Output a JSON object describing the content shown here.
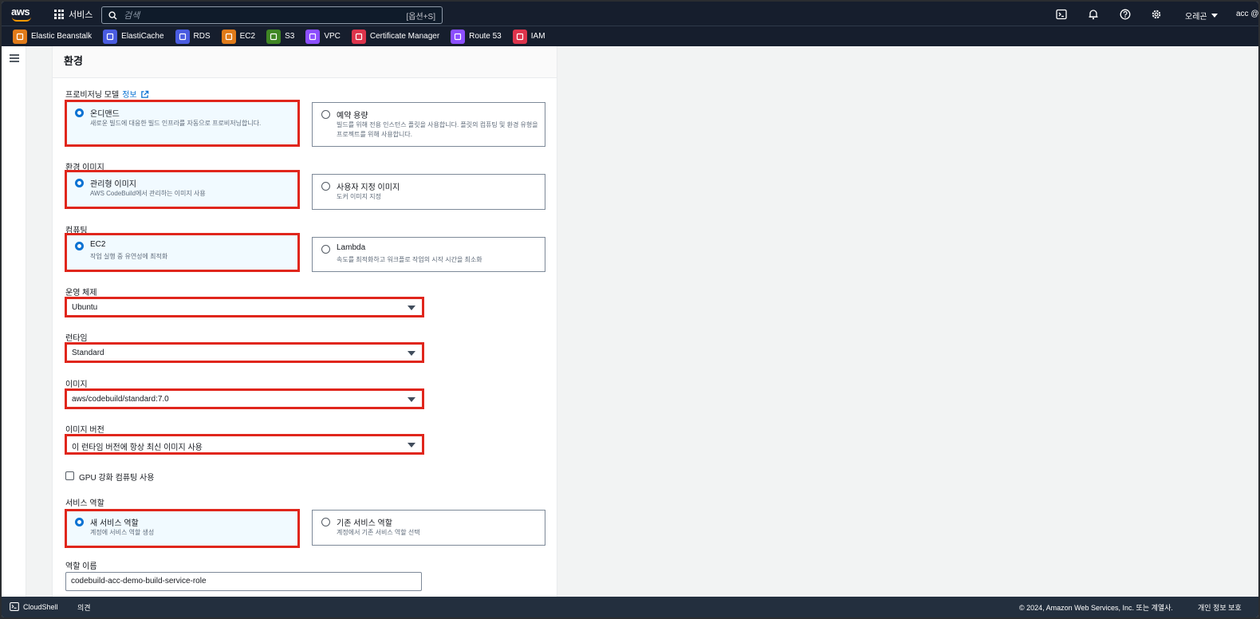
{
  "topnav": {
    "logo": "aws",
    "services_label": "서비스",
    "search_placeholder": "검색",
    "search_shortcut": "[옵션+S]",
    "region": "오레곤",
    "account": "acc @"
  },
  "favorites": [
    {
      "label": "Elastic Beanstalk",
      "color": "#e07b1a"
    },
    {
      "label": "ElastiCache",
      "color": "#4a5ce0"
    },
    {
      "label": "RDS",
      "color": "#4a5ce0"
    },
    {
      "label": "EC2",
      "color": "#e07b1a"
    },
    {
      "label": "S3",
      "color": "#3f8624"
    },
    {
      "label": "VPC",
      "color": "#8c4fff"
    },
    {
      "label": "Certificate Manager",
      "color": "#dd344c"
    },
    {
      "label": "Route 53",
      "color": "#8c4fff"
    },
    {
      "label": "IAM",
      "color": "#dd344c"
    }
  ],
  "panel": {
    "title": "환경",
    "provisioning": {
      "label": "프로비저닝 모델",
      "info": "정보",
      "options": [
        {
          "title": "온디맨드",
          "desc": "새로운 빌드에 대응한 빌드 인프라를 자동으로 프로비저닝합니다.",
          "selected": true
        },
        {
          "title": "예약 용량",
          "desc": "빌드를 위해 전용 인스턴스 플릿을 사용합니다. 플릿의 컴퓨팅 및 환경 유형을 프로젝트를 위해 사용합니다.",
          "selected": false
        }
      ]
    },
    "env_image": {
      "label": "환경 이미지",
      "options": [
        {
          "title": "관리형 이미지",
          "desc": "AWS CodeBuild에서 관리하는 이미지 사용",
          "selected": true
        },
        {
          "title": "사용자 지정 이미지",
          "desc": "도커 이미지 지정",
          "selected": false
        }
      ]
    },
    "compute": {
      "label": "컴퓨팅",
      "options": [
        {
          "title": "EC2",
          "desc": "작업 실행 중 유연성에 최적화",
          "selected": true
        },
        {
          "title": "Lambda",
          "desc": "속도를 최적화하고 워크플로 작업의 시작 시간을 최소화",
          "selected": false
        }
      ]
    },
    "os": {
      "label": "운영 체제",
      "value": "Ubuntu"
    },
    "runtime": {
      "label": "런타임",
      "value": "Standard"
    },
    "image": {
      "label": "이미지",
      "value": "aws/codebuild/standard:7.0"
    },
    "image_version": {
      "label": "이미지 버전",
      "value": "이 런타임 버전에 항상 최신 이미지 사용"
    },
    "gpu": {
      "label": "GPU 강화 컴퓨팅 사용",
      "checked": false
    },
    "service_role": {
      "label": "서비스 역할",
      "options": [
        {
          "title": "새 서비스 역할",
          "desc": "계정에 서비스 역할 생성",
          "selected": true
        },
        {
          "title": "기존 서비스 역할",
          "desc": "계정에서 기존 서비스 역할 선택",
          "selected": false
        }
      ]
    },
    "role_name": {
      "label": "역할 이름",
      "value": "codebuild-acc-demo-build-service-role"
    }
  },
  "footer": {
    "cloudshell": "CloudShell",
    "feedback": "의견",
    "copyright": "© 2024, Amazon Web Services, Inc. 또는 계열사.",
    "privacy": "개인 정보 보호"
  },
  "colors": {
    "nav_bg": "#161e2d",
    "footer_bg": "#232f3e",
    "highlight": "#e0261c",
    "link": "#0972d3"
  }
}
